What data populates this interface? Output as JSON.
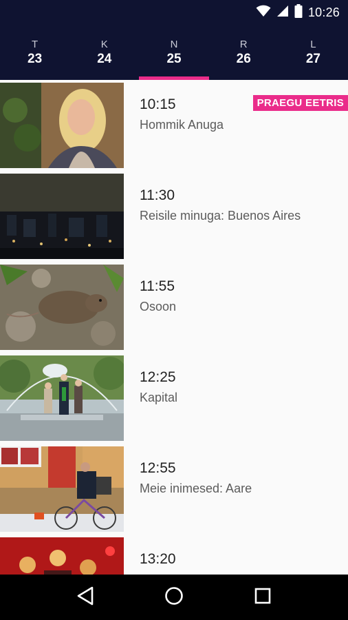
{
  "status_bar": {
    "time": "10:26"
  },
  "days": [
    {
      "dow": "T",
      "num": "23",
      "active": false
    },
    {
      "dow": "K",
      "num": "24",
      "active": false
    },
    {
      "dow": "N",
      "num": "25",
      "active": true
    },
    {
      "dow": "R",
      "num": "26",
      "active": false
    },
    {
      "dow": "L",
      "num": "27",
      "active": false
    }
  ],
  "schedule": [
    {
      "time": "10:15",
      "title": "Hommik Anuga",
      "badge": "PRAEGU EETRIS"
    },
    {
      "time": "11:30",
      "title": "Reisile minuga: Buenos Aires"
    },
    {
      "time": "11:55",
      "title": "Osoon"
    },
    {
      "time": "12:25",
      "title": "Kapital"
    },
    {
      "time": "12:55",
      "title": "Meie inimesed: Aare"
    },
    {
      "time": "13:20",
      "title": ""
    }
  ],
  "nav": {
    "back": "back-icon",
    "home": "home-icon",
    "recents": "recents-icon"
  },
  "colors": {
    "header_bg": "#0f1331",
    "accent": "#ea2c8a",
    "nav_bg": "#000000"
  }
}
